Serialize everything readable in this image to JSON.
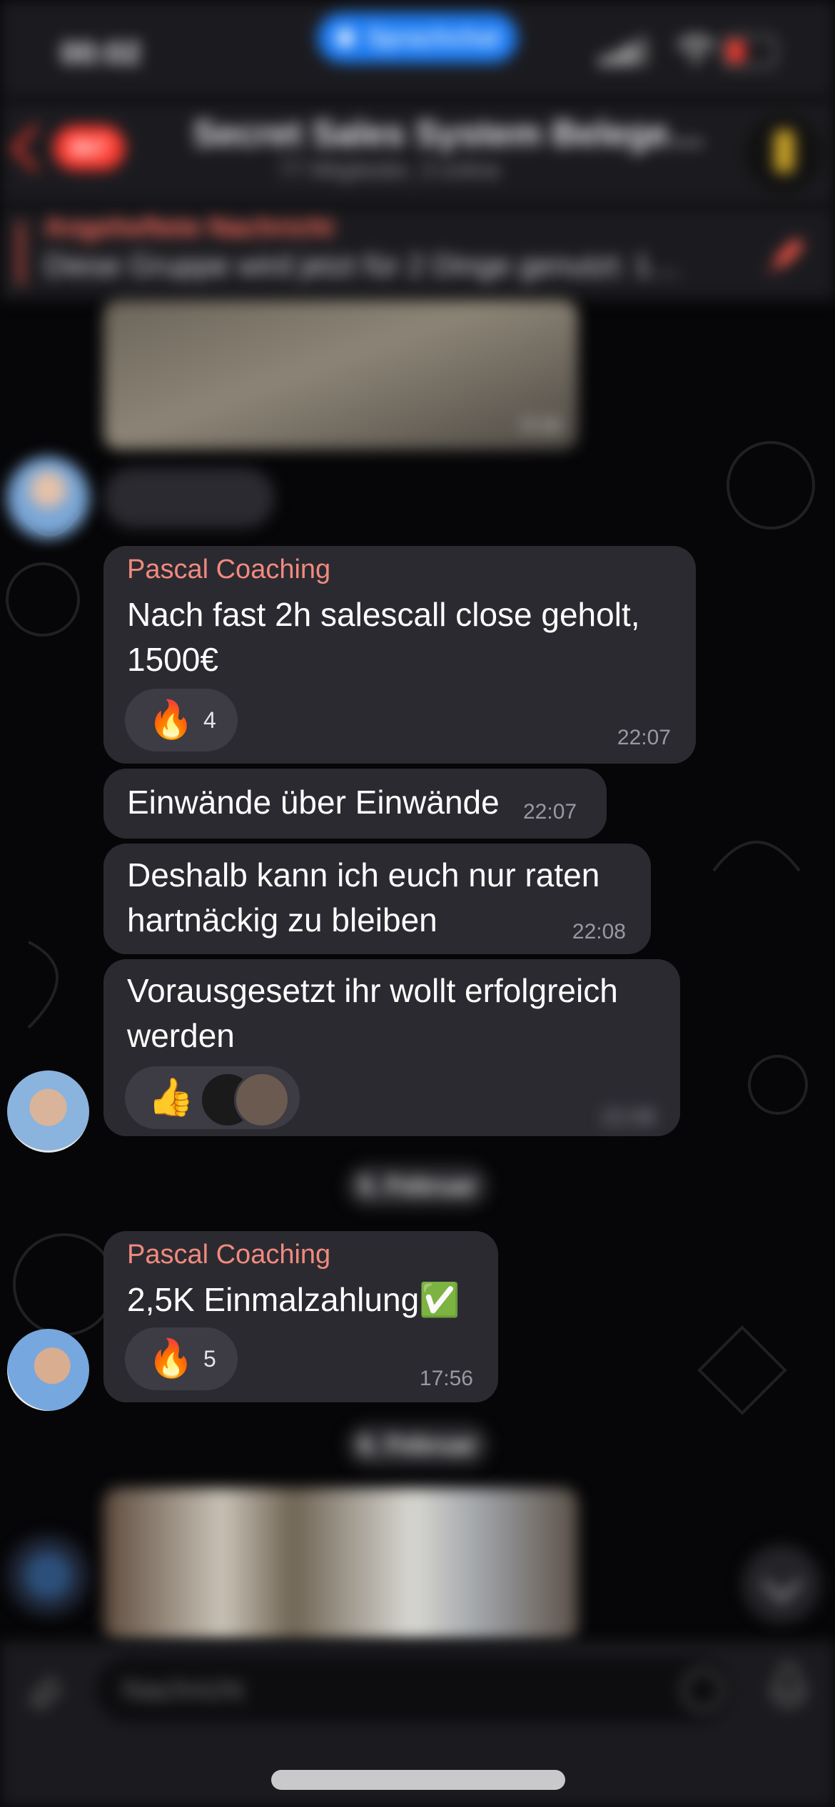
{
  "status_bar": {
    "time": "00:02",
    "call_pill": "Sprachchat"
  },
  "header": {
    "back_badge": "867",
    "title": "Secret Sales System Belege…",
    "subtitle": "77 Mitglieder, 3 online"
  },
  "pinned": {
    "title": "Angeheftete Nachricht",
    "text": "Diese Gruppe wird jetzt für 2 Dinge genutzt: 1…"
  },
  "messages": [
    {
      "sender": "Pascal Coaching",
      "text": "Nach fast 2h salescall close geholt, 1500€",
      "time": "22:07",
      "reaction": {
        "emoji": "🔥",
        "count": "4"
      }
    },
    {
      "text": "Einwände über Einwände",
      "time": "22:07"
    },
    {
      "text": "Deshalb kann ich euch nur raten hartnäckig zu bleiben",
      "time": "22:08"
    },
    {
      "text": "Vorausgesetzt ihr wollt erfolgreich werden",
      "time": "22:08",
      "reaction": {
        "emoji": "👍"
      }
    },
    {
      "sender": "Pascal Coaching",
      "text": "2,5K Einmalzahlung✅",
      "time": "17:56",
      "reaction": {
        "emoji": "🔥",
        "count": "5"
      }
    }
  ],
  "media": {
    "duration": "0:16"
  },
  "date_separators": [
    "5. Februar",
    "6. Februar"
  ],
  "input": {
    "placeholder": "Nachricht"
  },
  "colors": {
    "accent": "#1f7ef5",
    "sender": "#f08a7e",
    "bubble": "#2c2a31",
    "badge": "#ff3b30"
  }
}
